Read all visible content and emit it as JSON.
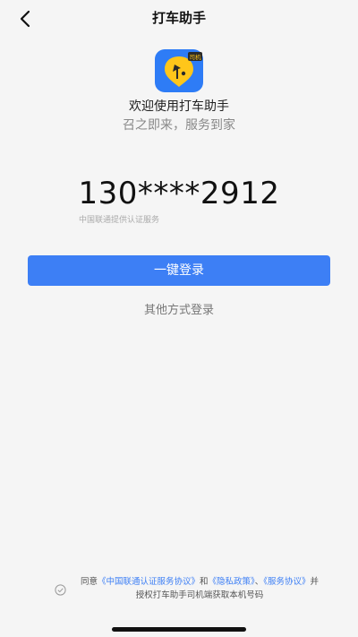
{
  "nav": {
    "title": "打车助手",
    "back_icon": "chevron-left-icon"
  },
  "app": {
    "logo_icon": "app-logo-icon",
    "logo_badge": "司机",
    "welcome": "欢迎使用打车助手",
    "slogan": "召之即来，服务到家"
  },
  "login": {
    "phone_masked": "130****2912",
    "provider_note": "中国联通提供认证服务",
    "one_click_label": "一键登录",
    "other_methods_label": "其他方式登录"
  },
  "agreement": {
    "check_icon": "check-circle-icon",
    "prefix": "同意",
    "link_unicom": "《中国联通认证服务协议》",
    "sep_and": "和",
    "link_privacy": "《隐私政策》",
    "sep_comma": "、",
    "link_service": "《服务协议》",
    "suffix": "并授权打车助手司机端获取本机号码"
  },
  "colors": {
    "primary": "#3d7ff5",
    "background": "#f5f5f5",
    "logo_blue": "#2e7cf6",
    "logo_yellow": "#ffc61a"
  }
}
